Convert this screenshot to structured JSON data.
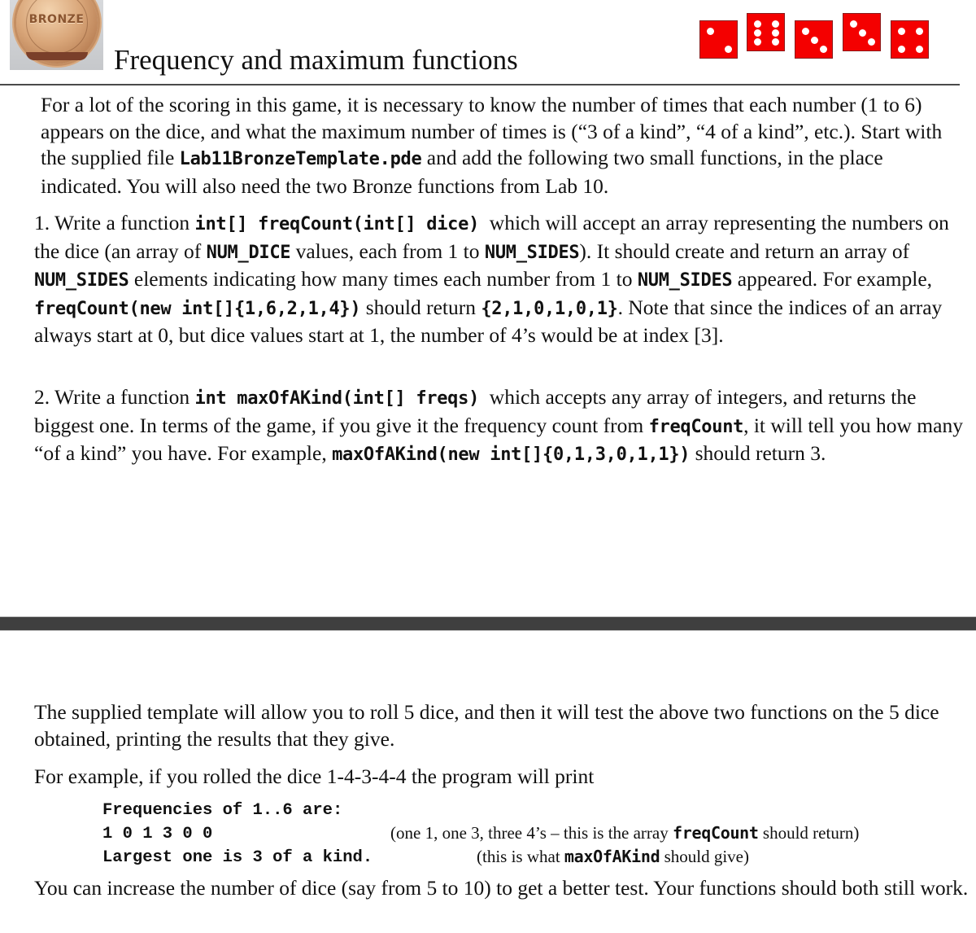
{
  "header": {
    "badge_label": "BRONZE",
    "title": "Frequency and maximum functions",
    "dice_faces": [
      2,
      6,
      3,
      3,
      4
    ],
    "dice_color": "#f40000"
  },
  "intro": {
    "t1": "For a lot of the scoring in this game, it is necessary to know the number of times that each number (1 to 6) appears on the dice, and what the maximum number of times is (“3 of a kind”, “4 of a kind”, etc.). Start with the supplied file ",
    "file": "Lab11BronzeTemplate.pde",
    "t2": " and add the following two small functions, in the place indicated. You will also need the two Bronze functions from Lab 10."
  },
  "task1": {
    "t1": "1. Write a function ",
    "sig": "int[] freqCount(int[] dice)",
    "t2": "  which will accept an array representing the numbers on the dice (an array of ",
    "c1": "NUM_DICE",
    "t3": " values, each from 1 to ",
    "c2": "NUM_SIDES",
    "t4": "). It should create and return an array of ",
    "c3": "NUM_SIDES",
    "t5": " elements indicating how many times each number from 1 to ",
    "c4": "NUM_SIDES",
    "t6": " appeared. For example, ",
    "c5": "freqCount(new int[]{1,6,2,1,4})",
    "t7": " should return ",
    "c6": "{2,1,0,1,0,1}",
    "t8": ". Note that since the indices of an array always start at 0, but dice values start at 1, the number of 4’s would be at index [3]."
  },
  "task2": {
    "t1": "2. Write a function ",
    "sig": "int maxOfAKind(int[] freqs)",
    "t2": "  which accepts any array of integers, and returns the biggest one. In terms of the game, if you give it the frequency count from ",
    "c1": "freqCount",
    "t3": ", it will tell you how many “of a kind” you have. For example, ",
    "c2": "maxOfAKind(new int[]{0,1,3,0,1,1})",
    "t4": " should return 3."
  },
  "section2": {
    "p1": "The supplied template will allow you to roll 5 dice, and then it will test the above two functions on the 5 dice obtained, printing the results that they give.",
    "p2": "For example, if you rolled the dice 1-4-3-4-4 the program will print",
    "output_lines": [
      "Frequencies of 1..6 are:",
      "1 0 1 3 0 0",
      "Largest one is 3 of a kind."
    ],
    "note1": {
      "t1": "(one 1, one 3, three 4’s – this is the array ",
      "code": "freqCount",
      "t2": " should return)"
    },
    "note2": {
      "t1": "(this is what ",
      "code": "maxOfAKind",
      "t2": " should give)"
    },
    "p3": "You can increase the number of dice (say from 5 to 10) to get a better test. Your functions should both still work."
  }
}
